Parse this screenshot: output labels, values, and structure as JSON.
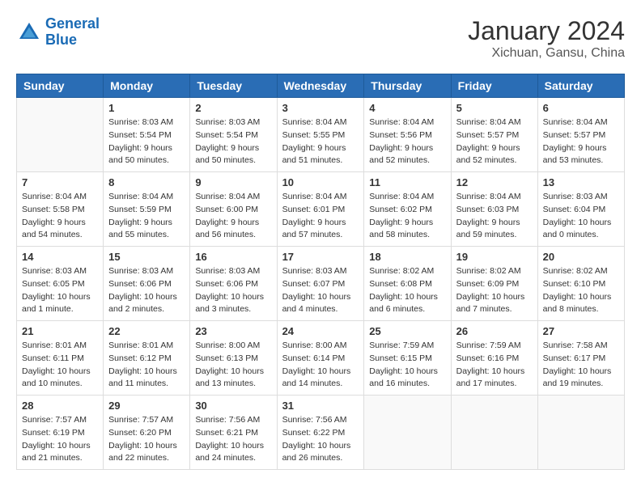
{
  "logo": {
    "text_general": "General",
    "text_blue": "Blue"
  },
  "title": "January 2024",
  "subtitle": "Xichuan, Gansu, China",
  "weekdays": [
    "Sunday",
    "Monday",
    "Tuesday",
    "Wednesday",
    "Thursday",
    "Friday",
    "Saturday"
  ],
  "weeks": [
    [
      {
        "day": "",
        "info": ""
      },
      {
        "day": "1",
        "info": "Sunrise: 8:03 AM\nSunset: 5:54 PM\nDaylight: 9 hours\nand 50 minutes."
      },
      {
        "day": "2",
        "info": "Sunrise: 8:03 AM\nSunset: 5:54 PM\nDaylight: 9 hours\nand 50 minutes."
      },
      {
        "day": "3",
        "info": "Sunrise: 8:04 AM\nSunset: 5:55 PM\nDaylight: 9 hours\nand 51 minutes."
      },
      {
        "day": "4",
        "info": "Sunrise: 8:04 AM\nSunset: 5:56 PM\nDaylight: 9 hours\nand 52 minutes."
      },
      {
        "day": "5",
        "info": "Sunrise: 8:04 AM\nSunset: 5:57 PM\nDaylight: 9 hours\nand 52 minutes."
      },
      {
        "day": "6",
        "info": "Sunrise: 8:04 AM\nSunset: 5:57 PM\nDaylight: 9 hours\nand 53 minutes."
      }
    ],
    [
      {
        "day": "7",
        "info": "Sunrise: 8:04 AM\nSunset: 5:58 PM\nDaylight: 9 hours\nand 54 minutes."
      },
      {
        "day": "8",
        "info": "Sunrise: 8:04 AM\nSunset: 5:59 PM\nDaylight: 9 hours\nand 55 minutes."
      },
      {
        "day": "9",
        "info": "Sunrise: 8:04 AM\nSunset: 6:00 PM\nDaylight: 9 hours\nand 56 minutes."
      },
      {
        "day": "10",
        "info": "Sunrise: 8:04 AM\nSunset: 6:01 PM\nDaylight: 9 hours\nand 57 minutes."
      },
      {
        "day": "11",
        "info": "Sunrise: 8:04 AM\nSunset: 6:02 PM\nDaylight: 9 hours\nand 58 minutes."
      },
      {
        "day": "12",
        "info": "Sunrise: 8:04 AM\nSunset: 6:03 PM\nDaylight: 9 hours\nand 59 minutes."
      },
      {
        "day": "13",
        "info": "Sunrise: 8:03 AM\nSunset: 6:04 PM\nDaylight: 10 hours\nand 0 minutes."
      }
    ],
    [
      {
        "day": "14",
        "info": "Sunrise: 8:03 AM\nSunset: 6:05 PM\nDaylight: 10 hours\nand 1 minute."
      },
      {
        "day": "15",
        "info": "Sunrise: 8:03 AM\nSunset: 6:06 PM\nDaylight: 10 hours\nand 2 minutes."
      },
      {
        "day": "16",
        "info": "Sunrise: 8:03 AM\nSunset: 6:06 PM\nDaylight: 10 hours\nand 3 minutes."
      },
      {
        "day": "17",
        "info": "Sunrise: 8:03 AM\nSunset: 6:07 PM\nDaylight: 10 hours\nand 4 minutes."
      },
      {
        "day": "18",
        "info": "Sunrise: 8:02 AM\nSunset: 6:08 PM\nDaylight: 10 hours\nand 6 minutes."
      },
      {
        "day": "19",
        "info": "Sunrise: 8:02 AM\nSunset: 6:09 PM\nDaylight: 10 hours\nand 7 minutes."
      },
      {
        "day": "20",
        "info": "Sunrise: 8:02 AM\nSunset: 6:10 PM\nDaylight: 10 hours\nand 8 minutes."
      }
    ],
    [
      {
        "day": "21",
        "info": "Sunrise: 8:01 AM\nSunset: 6:11 PM\nDaylight: 10 hours\nand 10 minutes."
      },
      {
        "day": "22",
        "info": "Sunrise: 8:01 AM\nSunset: 6:12 PM\nDaylight: 10 hours\nand 11 minutes."
      },
      {
        "day": "23",
        "info": "Sunrise: 8:00 AM\nSunset: 6:13 PM\nDaylight: 10 hours\nand 13 minutes."
      },
      {
        "day": "24",
        "info": "Sunrise: 8:00 AM\nSunset: 6:14 PM\nDaylight: 10 hours\nand 14 minutes."
      },
      {
        "day": "25",
        "info": "Sunrise: 7:59 AM\nSunset: 6:15 PM\nDaylight: 10 hours\nand 16 minutes."
      },
      {
        "day": "26",
        "info": "Sunrise: 7:59 AM\nSunset: 6:16 PM\nDaylight: 10 hours\nand 17 minutes."
      },
      {
        "day": "27",
        "info": "Sunrise: 7:58 AM\nSunset: 6:17 PM\nDaylight: 10 hours\nand 19 minutes."
      }
    ],
    [
      {
        "day": "28",
        "info": "Sunrise: 7:57 AM\nSunset: 6:19 PM\nDaylight: 10 hours\nand 21 minutes."
      },
      {
        "day": "29",
        "info": "Sunrise: 7:57 AM\nSunset: 6:20 PM\nDaylight: 10 hours\nand 22 minutes."
      },
      {
        "day": "30",
        "info": "Sunrise: 7:56 AM\nSunset: 6:21 PM\nDaylight: 10 hours\nand 24 minutes."
      },
      {
        "day": "31",
        "info": "Sunrise: 7:56 AM\nSunset: 6:22 PM\nDaylight: 10 hours\nand 26 minutes."
      },
      {
        "day": "",
        "info": ""
      },
      {
        "day": "",
        "info": ""
      },
      {
        "day": "",
        "info": ""
      }
    ]
  ]
}
